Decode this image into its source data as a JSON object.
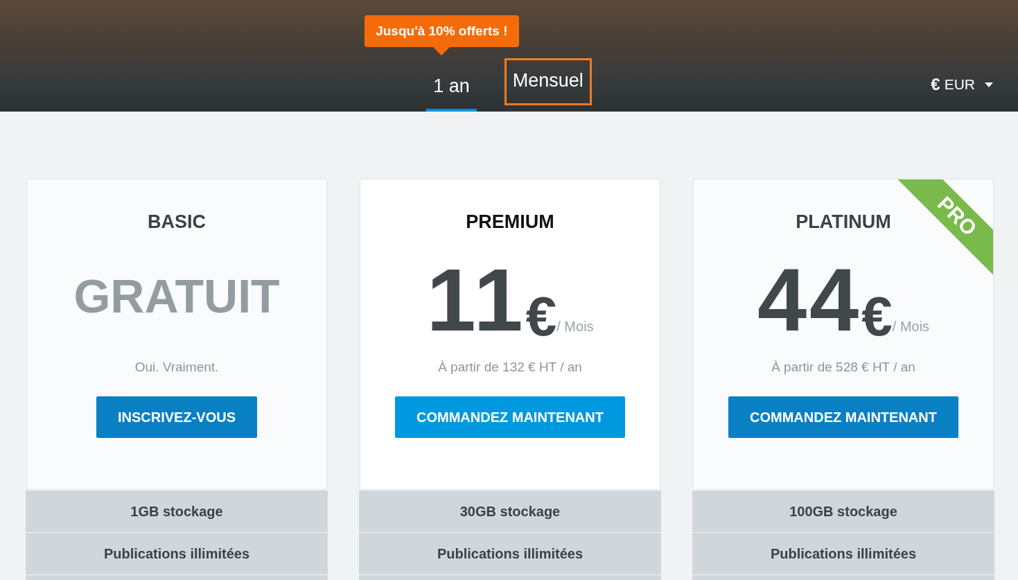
{
  "header": {
    "promo_badge": "Jusqu'à 10% offerts !",
    "billing_tabs": [
      {
        "label": "1 an",
        "selected": true,
        "focused": false
      },
      {
        "label": "Mensuel",
        "selected": false,
        "focused": true
      }
    ],
    "currency": {
      "symbol": "€",
      "code": "EUR"
    }
  },
  "plans": [
    {
      "kind": "free",
      "title": "BASIC",
      "featured": false,
      "price": "GRATUIT",
      "subtitle": "Oui. Vraiment.",
      "button": "INSCRIVEZ-VOUS",
      "features": [
        "1GB stockage",
        "Publications illimitées"
      ]
    },
    {
      "kind": "paid",
      "title": "PREMIUM",
      "featured": true,
      "amount": "11",
      "currency": "€",
      "period": "/ Mois",
      "subtitle": "À partir de 132 € HT / an",
      "button": "COMMANDEZ MAINTENANT",
      "features": [
        "30GB stockage",
        "Publications illimitées"
      ]
    },
    {
      "kind": "paid",
      "title": "PLATINUM",
      "featured": false,
      "ribbon": "PRO",
      "amount": "44",
      "currency": "€",
      "period": "/ Mois",
      "subtitle": "À partir de 528 € HT / an",
      "button": "COMMANDEZ MAINTENANT",
      "features": [
        "100GB stockage",
        "Publications illimitées"
      ]
    }
  ]
}
